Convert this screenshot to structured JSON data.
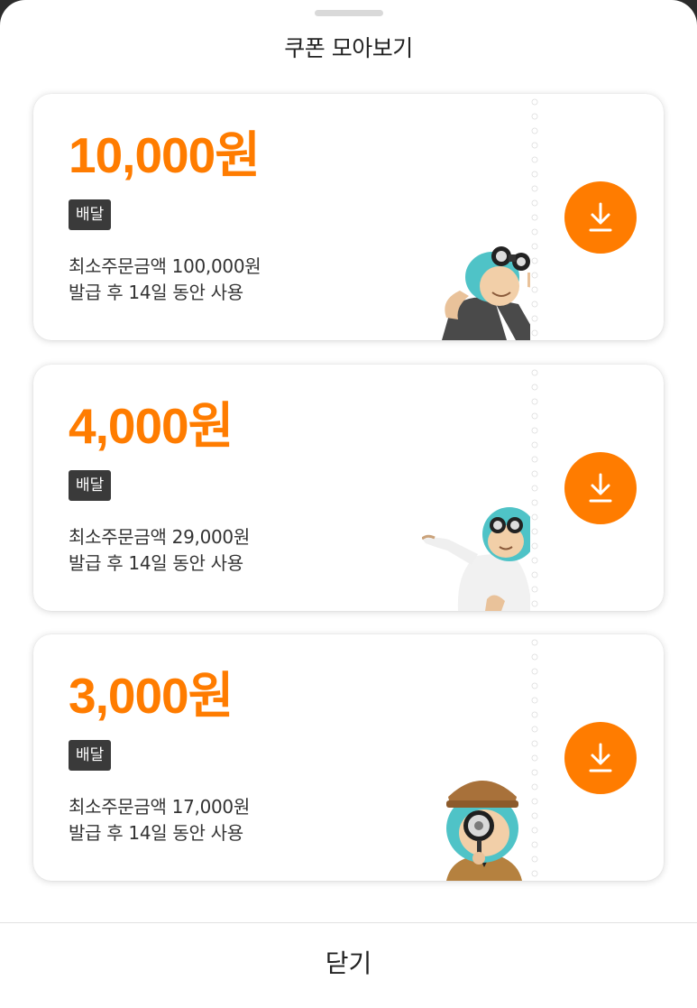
{
  "sheet": {
    "title": "쿠폰 모아보기",
    "close_label": "닫기"
  },
  "colors": {
    "accent": "#ff7c00",
    "tag_bg": "#3a3a3a"
  },
  "coupons": [
    {
      "amount": "10,000원",
      "tag": "배달",
      "min_order": "최소주문금액 100,000원",
      "validity": "발급 후 14일 동안 사용",
      "icon": "download-icon",
      "mascot": "binoculars-mascot"
    },
    {
      "amount": "4,000원",
      "tag": "배달",
      "min_order": "최소주문금액 29,000원",
      "validity": "발급 후 14일 동안 사용",
      "icon": "download-icon",
      "mascot": "presenting-mascot"
    },
    {
      "amount": "3,000원",
      "tag": "배달",
      "min_order": "최소주문금액 17,000원",
      "validity": "발급 후 14일 동안 사용",
      "icon": "download-icon",
      "mascot": "detective-mascot"
    }
  ]
}
